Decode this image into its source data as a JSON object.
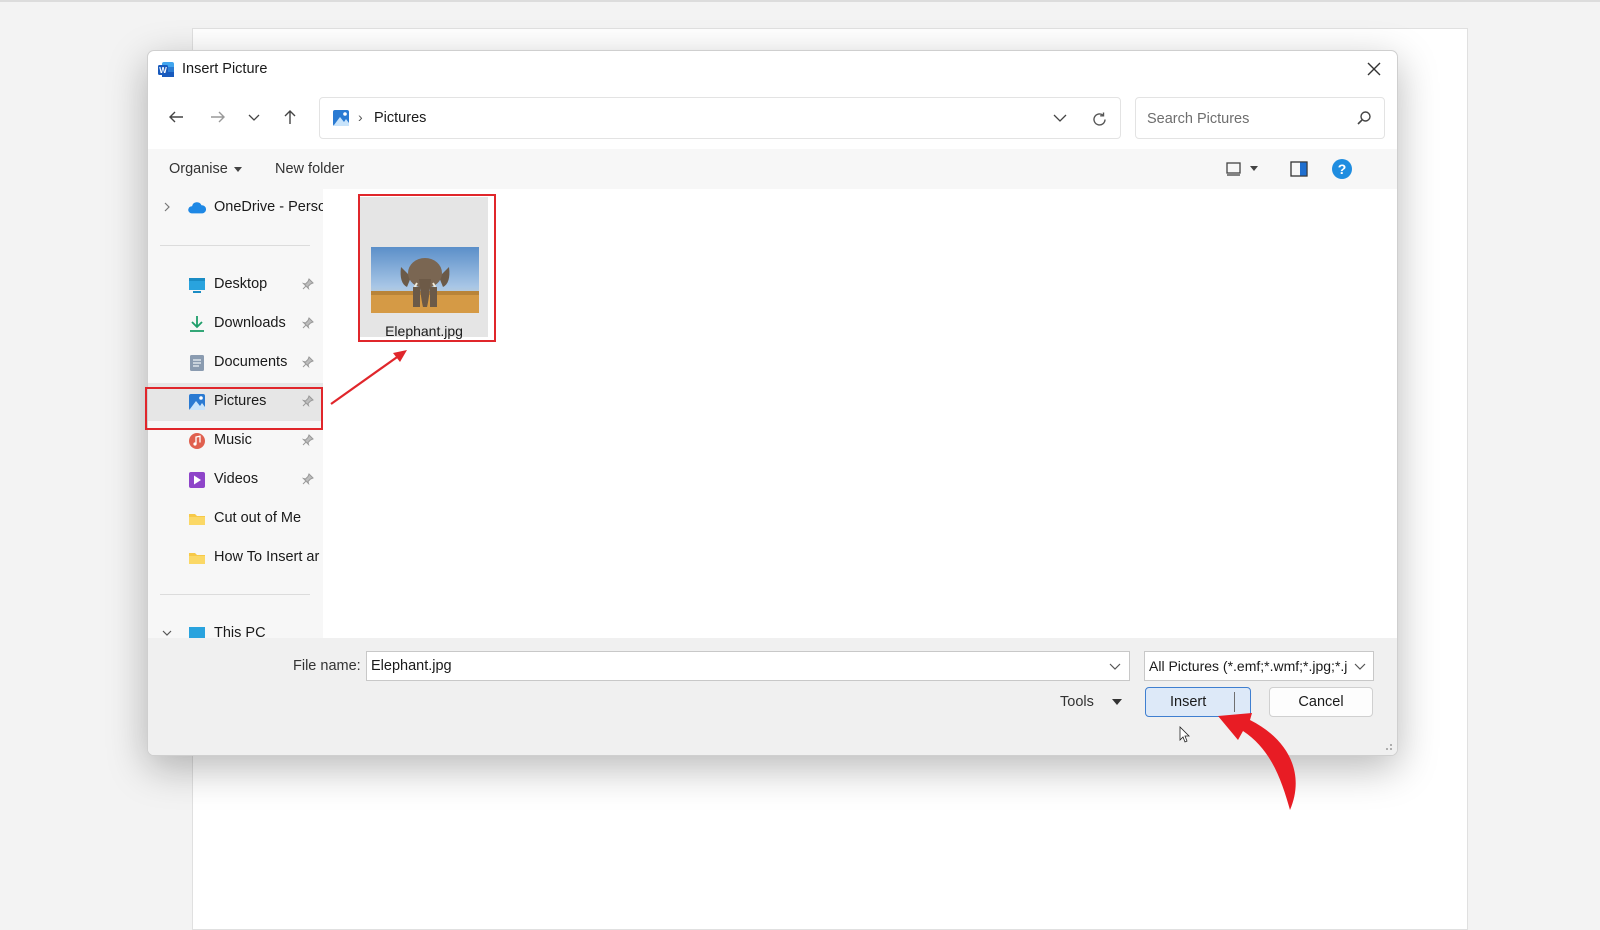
{
  "dialog": {
    "title": "Insert Picture",
    "close_label": "×"
  },
  "address": {
    "current": "Pictures",
    "separator": "›"
  },
  "search": {
    "placeholder": "Search Pictures"
  },
  "toolbar": {
    "organise": "Organise",
    "new_folder": "New folder"
  },
  "sidebar": {
    "onedrive": "OneDrive - Perso",
    "items": [
      {
        "label": "Desktop",
        "icon": "desktop-icon",
        "pinned": true
      },
      {
        "label": "Downloads",
        "icon": "downloads-icon",
        "pinned": true
      },
      {
        "label": "Documents",
        "icon": "documents-icon",
        "pinned": true
      },
      {
        "label": "Pictures",
        "icon": "pictures-icon",
        "pinned": true,
        "selected": true
      },
      {
        "label": "Music",
        "icon": "music-icon",
        "pinned": true
      },
      {
        "label": "Videos",
        "icon": "videos-icon",
        "pinned": true
      },
      {
        "label": "Cut out of Me",
        "icon": "folder-icon",
        "pinned": false
      },
      {
        "label": "How To Insert ar",
        "icon": "folder-icon",
        "pinned": false
      }
    ],
    "this_pc": "This PC"
  },
  "files": [
    {
      "name": "Elephant.jpg",
      "selected": true
    }
  ],
  "footer": {
    "file_name_label": "File name:",
    "file_name_value": "Elephant.jpg",
    "file_type": "All Pictures (*.emf;*.wmf;*.jpg;*.j",
    "tools": "Tools",
    "insert": "Insert",
    "cancel": "Cancel"
  },
  "colors": {
    "accent": "#3f7fd0",
    "highlight": "#e0262b",
    "help": "#1f8de0"
  }
}
